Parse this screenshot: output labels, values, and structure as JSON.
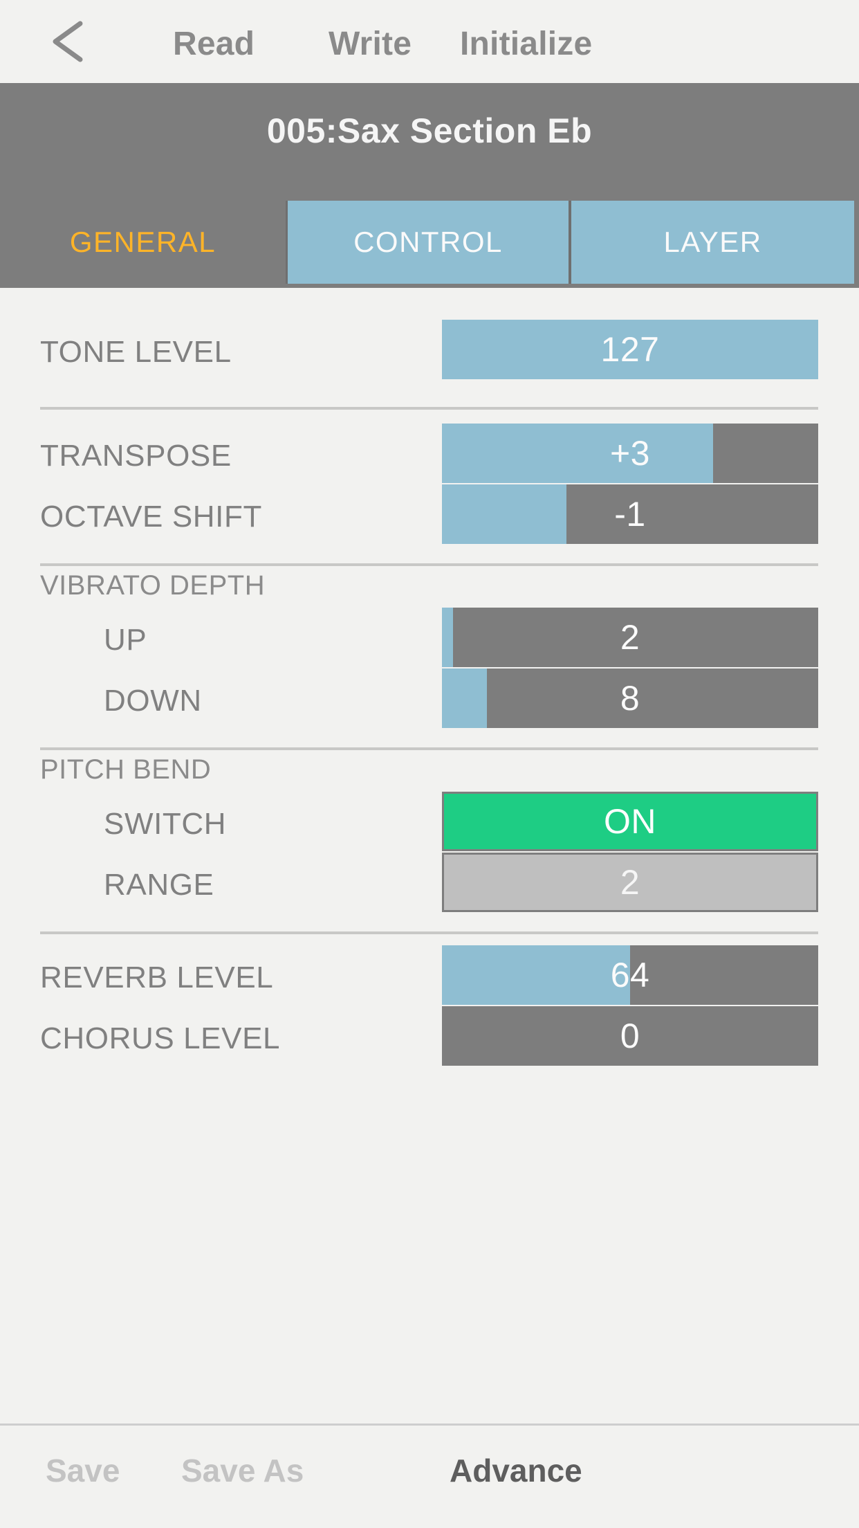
{
  "navbar": {
    "back_icon": "chevron-left-icon",
    "read_label": "Read",
    "write_label": "Write",
    "initialize_label": "Initialize"
  },
  "header": {
    "patch_title": "005:Sax Section Eb"
  },
  "tabs": [
    {
      "label": "GENERAL",
      "active": true
    },
    {
      "label": "CONTROL",
      "active": false
    },
    {
      "label": "LAYER",
      "active": false
    }
  ],
  "parameters": {
    "tone_level": {
      "label": "TONE LEVEL",
      "value": "127",
      "fill_percent": 100
    },
    "transpose": {
      "label": "TRANSPOSE",
      "value": "+3",
      "fill_percent": 72
    },
    "octave_shift": {
      "label": "OCTAVE SHIFT",
      "value": "-1",
      "fill_percent": 33
    },
    "vibrato_depth": {
      "label": "VIBRATO DEPTH"
    },
    "vibrato_up": {
      "label": "UP",
      "value": "2",
      "fill_percent": 3
    },
    "vibrato_down": {
      "label": "DOWN",
      "value": "8",
      "fill_percent": 12
    },
    "pitch_bend": {
      "label": "PITCH BEND"
    },
    "pitch_switch": {
      "label": "SWITCH",
      "value": "ON"
    },
    "pitch_range": {
      "label": "RANGE",
      "value": "2"
    },
    "reverb_level": {
      "label": "REVERB LEVEL",
      "value": "64",
      "fill_percent": 50
    },
    "chorus_level": {
      "label": "CHORUS LEVEL",
      "value": "0",
      "fill_percent": 0
    }
  },
  "toolbar": {
    "save_label": "Save",
    "save_as_label": "Save As",
    "advance_label": "Advance"
  },
  "colors": {
    "accent_blue": "#8fbed2",
    "track_gray": "#7d7d7d",
    "active_tab_text": "#ffb428",
    "switch_on_green": "#1ecd84",
    "button_off_gray": "#bfbfbf",
    "page_background": "#f2f2f0"
  }
}
